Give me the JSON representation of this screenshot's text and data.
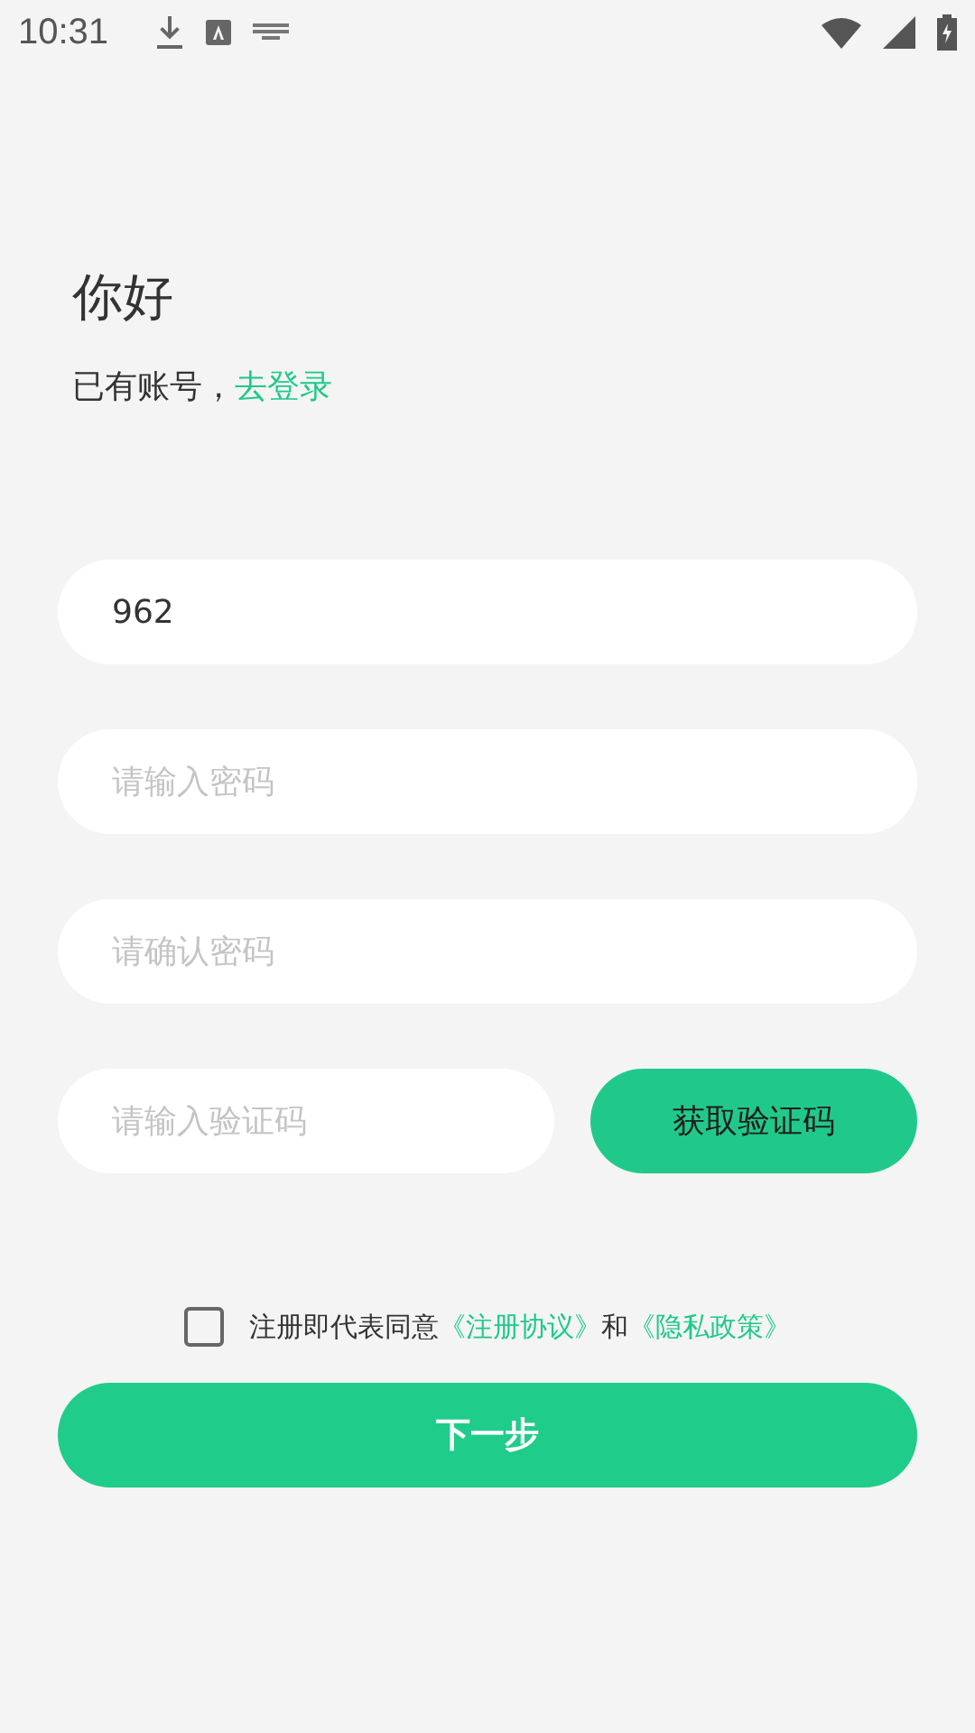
{
  "status_bar": {
    "time": "10:31"
  },
  "greeting": {
    "title": "你好",
    "prompt": "已有账号，",
    "link": "去登录"
  },
  "fields": [
    {
      "value": "962"
    },
    {
      "placeholder": "请输入密码"
    },
    {
      "placeholder": "请确认密码"
    },
    {
      "placeholder": "请输入验证码"
    }
  ],
  "code_button": "获取验证码",
  "agreement": {
    "checked": false,
    "parts": [
      {
        "kind": "text",
        "text": "注册即代表同意"
      },
      {
        "kind": "link",
        "text": "《注册协议》"
      },
      {
        "kind": "text",
        "text": "和"
      },
      {
        "kind": "link",
        "text": "《隐私政策》"
      }
    ]
  },
  "next_button": "下一步"
}
